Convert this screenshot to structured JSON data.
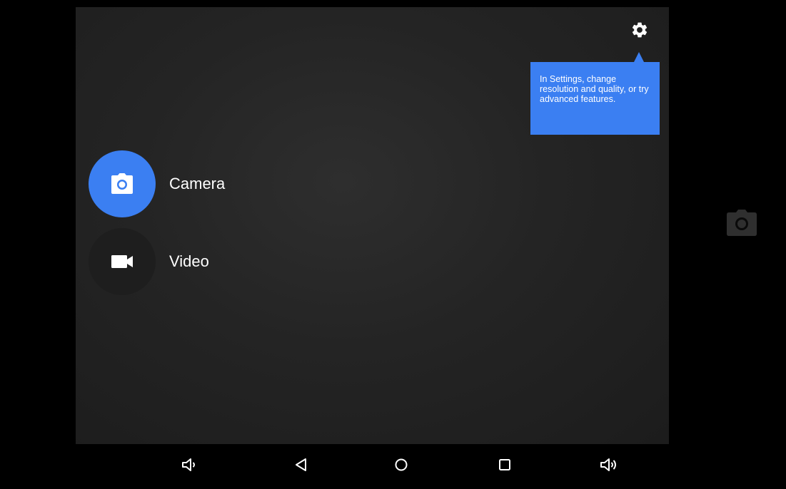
{
  "tooltip": {
    "text": "In Settings, change resolution and quality, or try advanced features."
  },
  "modes": {
    "camera": {
      "label": "Camera",
      "icon": "camera-icon",
      "selected": true
    },
    "video": {
      "label": "Video",
      "icon": "video-icon",
      "selected": false
    }
  },
  "icons": {
    "settings": "gear-icon",
    "shutter": "camera-icon",
    "nav": [
      "volume-down-icon",
      "back-icon",
      "home-icon",
      "recents-icon",
      "volume-up-icon"
    ]
  },
  "colors": {
    "accent": "#3b7ff2",
    "viewfinder": "#242424",
    "background": "#000000"
  }
}
